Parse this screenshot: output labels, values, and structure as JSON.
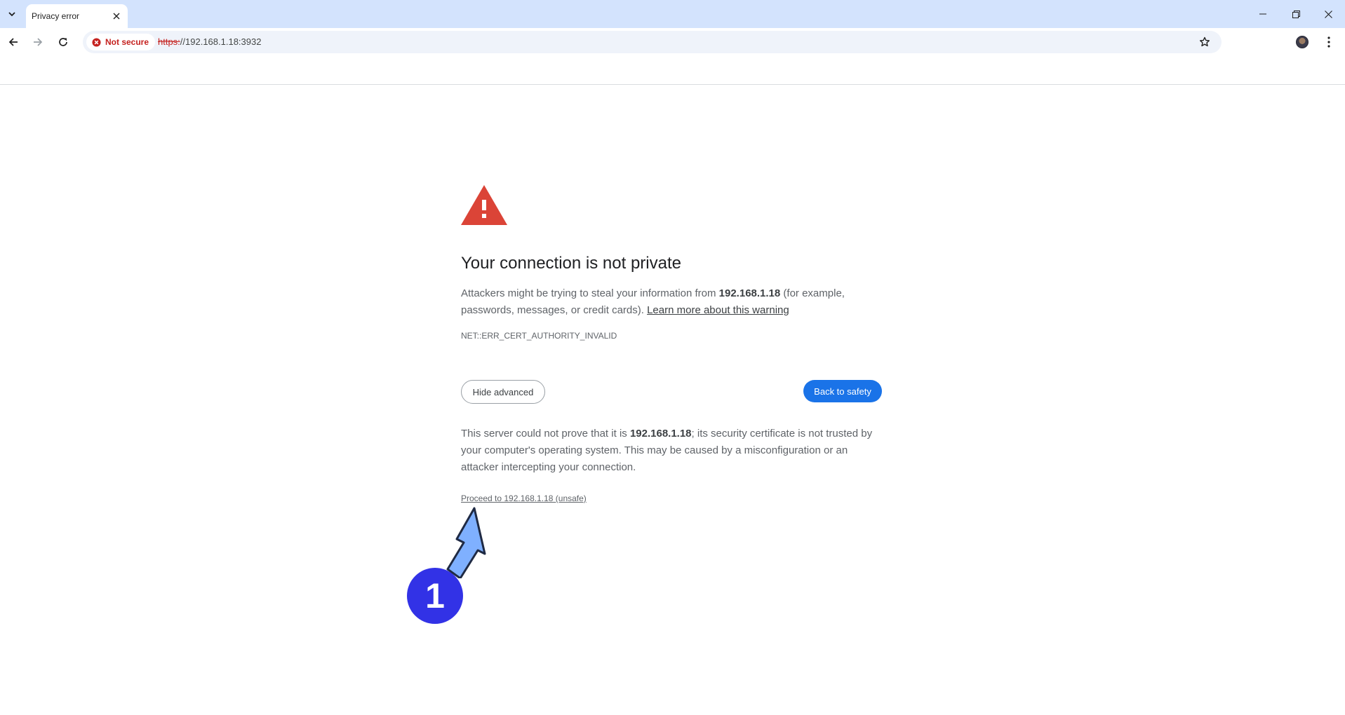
{
  "browser": {
    "tab": {
      "title": "Privacy error"
    },
    "security_chip": {
      "label": "Not secure",
      "icon": "error-circle-icon",
      "color": "#c5221f"
    },
    "url": {
      "scheme": "https:",
      "rest": "//192.168.1.18:3932"
    }
  },
  "page": {
    "icon": "warning-triangle-icon",
    "heading": "Your connection is not private",
    "intro": {
      "before": "Attackers might be trying to steal your information from ",
      "host": "192.168.1.18",
      "after": " (for example, passwords, messages, or credit cards). ",
      "learn_more": "Learn more about this warning"
    },
    "error_code": "NET::ERR_CERT_AUTHORITY_INVALID",
    "hide_advanced_label": "Hide advanced",
    "back_to_safety_label": "Back to safety",
    "details": {
      "before": "This server could not prove that it is ",
      "host": "192.168.1.18",
      "after": "; its security certificate is not trusted by your computer's operating system. This may be caused by a misconfiguration or an attacker intercepting your connection."
    },
    "proceed_link": "Proceed to 192.168.1.18 (unsafe)"
  },
  "annotation": {
    "step_number": "1",
    "badge_color": "#3232e6",
    "arrow_color": "#7fb0ff"
  },
  "colors": {
    "accent": "#1a73e8",
    "warning": "#db4437",
    "tabstrip": "#d3e3fd"
  }
}
